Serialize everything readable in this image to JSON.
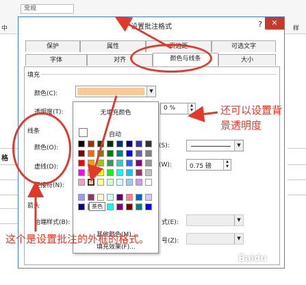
{
  "excel": {
    "style_box": "常规",
    "ribbon_left": "中",
    "ribbon_right": "样",
    "cell_label": "格"
  },
  "dialog": {
    "title": "设置批注格式",
    "help": "?",
    "close": "✕",
    "tabs_row1": [
      "保护",
      "属性",
      "页边距",
      "可选文字"
    ],
    "tabs_row2": [
      "字体",
      "对齐",
      "颜色与线条",
      "大小"
    ],
    "active_tab": "颜色与线条"
  },
  "fill": {
    "section": "填充",
    "color_label": "颜色(C):",
    "color_value": "#fbc897",
    "transparency_label": "透明度(T):",
    "transparency_value": "0 %"
  },
  "lines": {
    "section": "线条",
    "color_label": "颜色(O):",
    "dash_label": "虚线(D):",
    "connector_label": "连接符(N):",
    "style_label": "(S):",
    "weight_label": "(W):",
    "weight_value": "0.75 磅"
  },
  "arrows": {
    "section": "箭头",
    "begin_style_label": "始端样式(B):",
    "end_style_label": "式(E):",
    "end_size_label": "号(Z):"
  },
  "palette": {
    "no_fill": "无填充颜色",
    "automatic": "自动",
    "tooltip": "茶色",
    "more_colors": "其他颜色(M)...",
    "fill_effects": "填充效果(F)...",
    "rows": [
      [
        "#000000",
        "#993300",
        "#333300",
        "#003300",
        "#003366",
        "#000080",
        "#333399",
        "#333333"
      ],
      [
        "#800000",
        "#ff6600",
        "#808000",
        "#008000",
        "#008080",
        "#0000ff",
        "#666699",
        "#808080"
      ],
      [
        "#ff0000",
        "#ff9900",
        "#99cc00",
        "#339966",
        "#33cccc",
        "#3366ff",
        "#800080",
        "#969696"
      ],
      [
        "#ff00ff",
        "#ffcc00",
        "#ffff00",
        "#00ff00",
        "#00ffff",
        "#00ccff",
        "#993366",
        "#c0c0c0"
      ],
      [
        "#ff99cc",
        "#ffcc99",
        "#ffff99",
        "#ccffcc",
        "#ccffff",
        "#99ccff",
        "#cc99ff",
        "#ffffff"
      ],
      [
        "#9999ff",
        "#993366",
        "#ffffcc",
        "#ccffff",
        "#660066",
        "#ff8080",
        "#0066cc",
        "#ccccff"
      ],
      [
        "#000080",
        "#ff00ff",
        "#ffff00",
        "#00ffff",
        "#800080",
        "#800000",
        "#008080",
        "#0000ff"
      ]
    ]
  },
  "annotations": {
    "transparency": [
      "还可以设置背",
      "景透明度"
    ],
    "outline": "这个是设置批注的外框的格式。",
    "color": "#e23a2a"
  },
  "watermark": "Baidu"
}
